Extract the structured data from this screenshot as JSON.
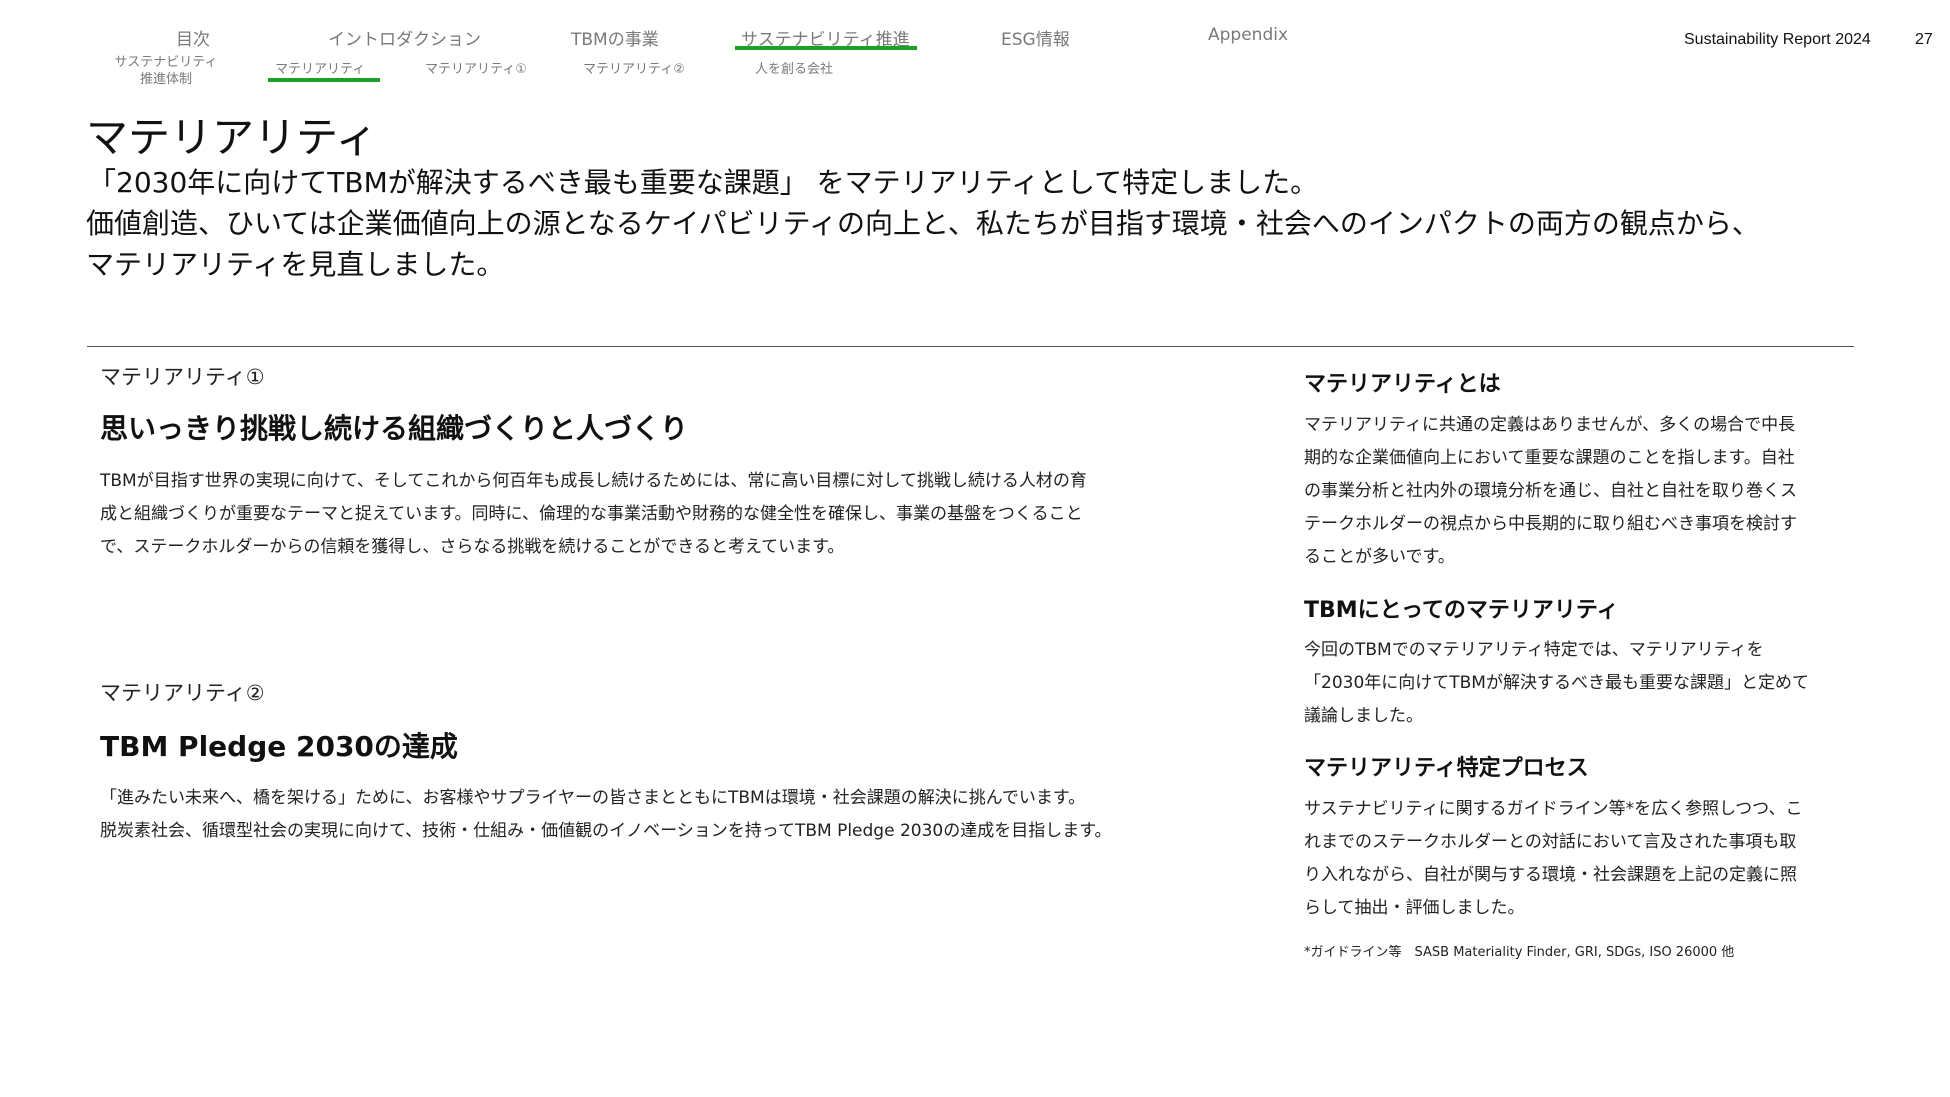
{
  "header": {
    "report_title": "Sustainability Report 2024",
    "page_number": "27"
  },
  "nav": {
    "main": [
      "目次",
      "イントロダクション",
      "TBMの事業",
      "サステナビリティ推進",
      "ESG情報",
      "Appendix"
    ],
    "sub": [
      "サステナビリティ\n推進体制",
      "マテリアリティ",
      "マテリアリティ①",
      "マテリアリティ②",
      "人を創る会社"
    ],
    "active_main": "サステナビリティ推進",
    "active_sub": "マテリアリティ",
    "accent_color": "#1aa31f"
  },
  "page": {
    "title": "マテリアリティ",
    "lead": [
      "「2030年に向けてTBMが解決するべき最も重要な課題」 をマテリアリティとして特定しました。",
      "価値創造、ひいては企業価値向上の源となるケイパビリティの向上と、私たちが目指す環境・社会へのインパクトの両方の観点から、",
      "マテリアリティを見直しました。"
    ]
  },
  "materiality_1": {
    "label": "マテリアリティ①",
    "heading": "思いっきり挑戦し続ける組織づくりと人づくり",
    "body": [
      "TBMが目指す世界の実現に向けて、そしてこれから何百年も成長し続けるためには、常に高い目標に対して挑戦し続ける人材の育",
      "成と組織づくりが重要なテーマと捉えています。同時に、倫理的な事業活動や財務的な健全性を確保し、事業の基盤をつくること",
      "で、ステークホルダーからの信頼を獲得し、さらなる挑戦を続けることができると考えています。"
    ]
  },
  "materiality_2": {
    "label": "マテリアリティ②",
    "heading": "TBM Pledge 2030の達成",
    "body": [
      "「進みたい未来へ、橋を架ける」ために、お客様やサプライヤーの皆さまとともにTBMは環境・社会課題の解決に挑んでいます。",
      "脱炭素社会、循環型社会の実現に向けて、技術・仕組み・価値観のイノベーションを持ってTBM Pledge 2030の達成を目指します。"
    ]
  },
  "sidebar": {
    "what_is": {
      "heading": "マテリアリティとは",
      "body": [
        "マテリアリティに共通の定義はありませんが、多くの場合で中長",
        "期的な企業価値向上において重要な課題のことを指します。自社",
        "の事業分析と社内外の環境分析を通じ、自社と自社を取り巻くス",
        "テークホルダーの視点から中長期的に取り組むべき事項を検討す",
        "ることが多いです。"
      ]
    },
    "for_tbm": {
      "heading": "TBMにとってのマテリアリティ",
      "body": [
        "今回のTBMでのマテリアリティ特定では、マテリアリティを",
        "「2030年に向けてTBMが解決するべき最も重要な課題」と定めて",
        "議論しました。"
      ]
    },
    "process": {
      "heading": "マテリアリティ特定プロセス",
      "body": [
        "サステナビリティに関するガイドライン等*を広く参照しつつ、こ",
        "れまでのステークホルダーとの対話において言及された事項も取",
        "り入れながら、自社が関与する環境・社会課題を上記の定義に照",
        "らして抽出・評価しました。"
      ]
    },
    "footnote": "*ガイドライン等　SASB Materiality Finder, GRI, SDGs, ISO 26000 他"
  }
}
